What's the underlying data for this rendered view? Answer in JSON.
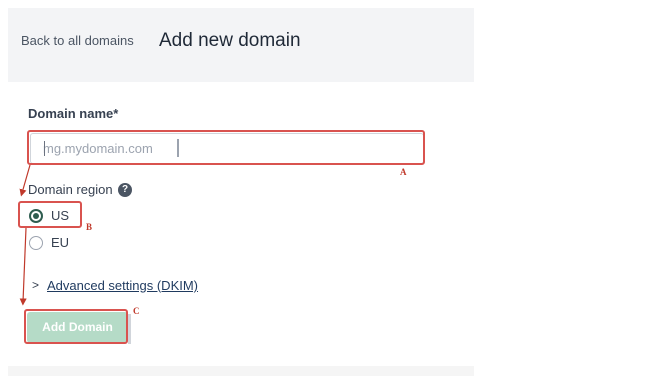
{
  "header": {
    "back_link": "Back to all domains",
    "title": "Add new domain"
  },
  "form": {
    "domain_label": "Domain name*",
    "domain_placeholder": "mg.mydomain.com",
    "domain_value": "",
    "region_label": "Domain region",
    "help_icon": "?",
    "regions": [
      {
        "label": "US",
        "selected": true
      },
      {
        "label": "EU",
        "selected": false
      }
    ],
    "advanced_chevron": ">",
    "advanced_label": "Advanced settings (DKIM)",
    "submit_label": "Add Domain"
  },
  "annotations": {
    "color": "#d9534f",
    "labels": [
      "A",
      "B",
      "C"
    ]
  },
  "colors": {
    "radio_selected": "#2f5d50",
    "button_disabled": "#b5dbc7",
    "link": "#1f3a5f"
  }
}
